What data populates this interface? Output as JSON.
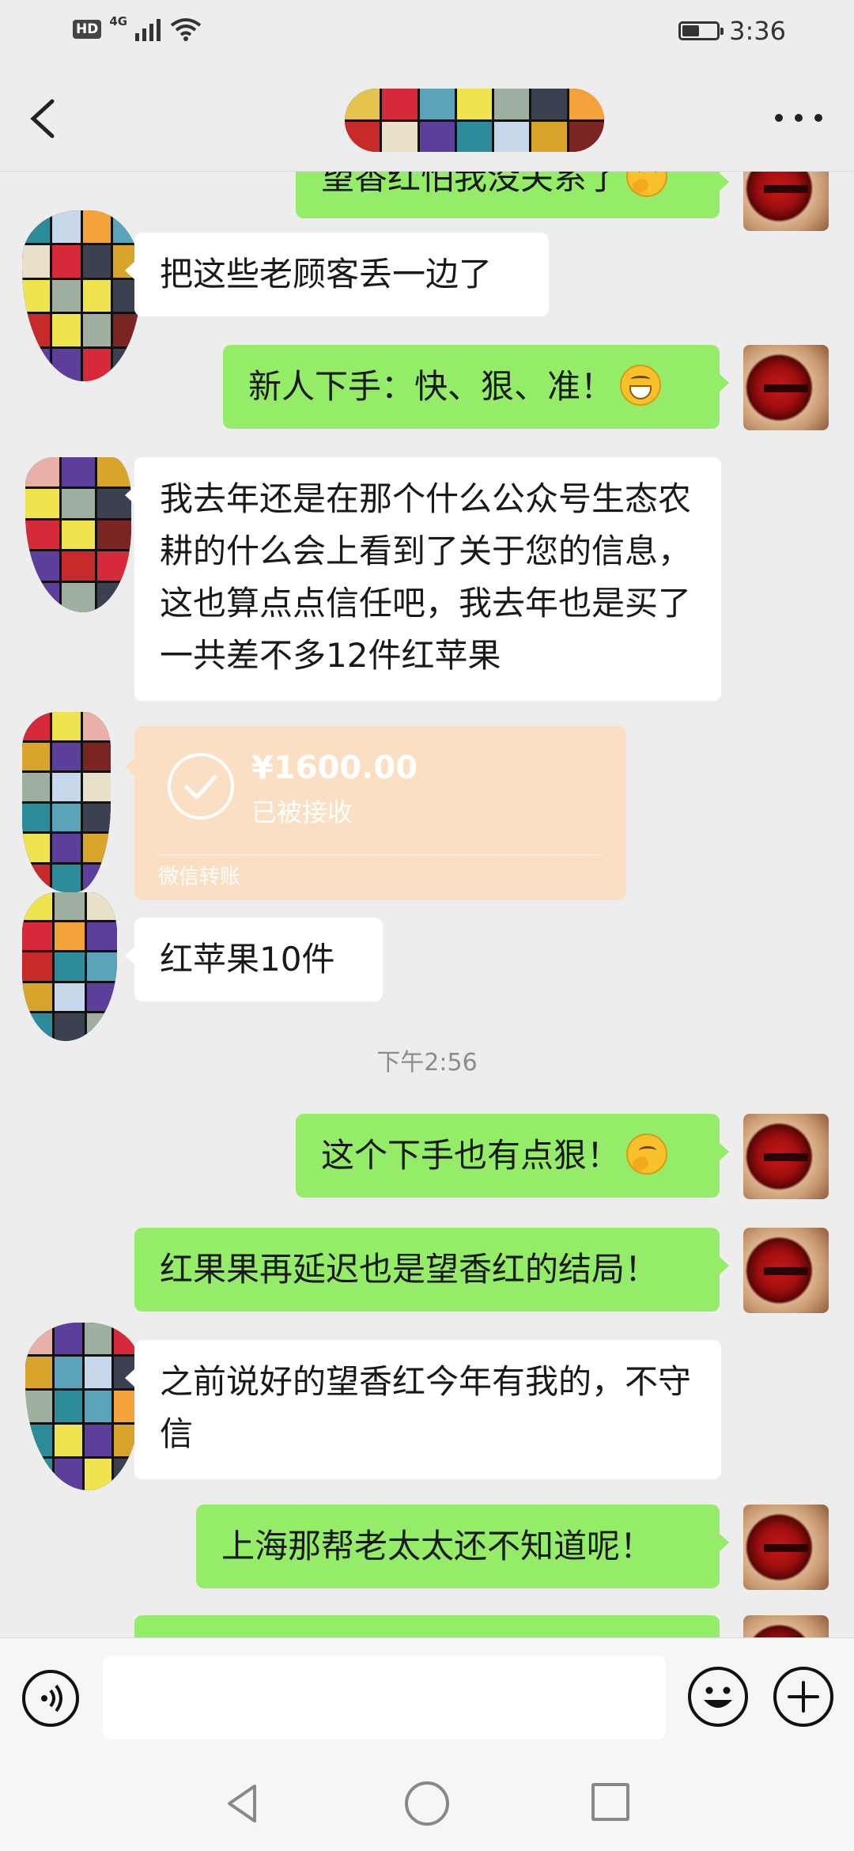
{
  "status_bar": {
    "network_badge": "HD",
    "network_type": "4G",
    "time": "3:36",
    "battery_level": 0.45
  },
  "header": {
    "contact_name": ""
  },
  "messages": [
    {
      "side": "out",
      "text": "望香红怕我没关系了"
    },
    {
      "side": "in",
      "text": "把这些老顾客丢一边了"
    },
    {
      "side": "out",
      "text": "新人下手：快、狠、准！",
      "emoji": "grinning-face"
    },
    {
      "side": "in",
      "text": "我去年还是在那个什么公众号生态农耕的什么会上看到了关于您的信息，这也算点点信任吧，我去年也是买了一共差不多12件红苹果"
    },
    {
      "side": "in",
      "text": "红苹果10件"
    },
    {
      "side": "out",
      "text": "这个下手也有点狠！",
      "emoji": "thinking-face"
    },
    {
      "side": "out",
      "text": "红果果再延迟也是望香红的结局！"
    },
    {
      "side": "in",
      "text": "之前说好的望香红今年有我的，不守信"
    },
    {
      "side": "out",
      "text": "上海那帮老太太还不知道呢！"
    }
  ],
  "transfer": {
    "amount": "¥1600.00",
    "status": "已被接收",
    "label": "微信转账"
  },
  "timestamp": "下午2:56",
  "input": {
    "value": ""
  },
  "colors": {
    "background": "#ededed",
    "outgoing_bubble": "#95ec69",
    "incoming_bubble": "#ffffff",
    "transfer_card": "#fbdfc2"
  }
}
